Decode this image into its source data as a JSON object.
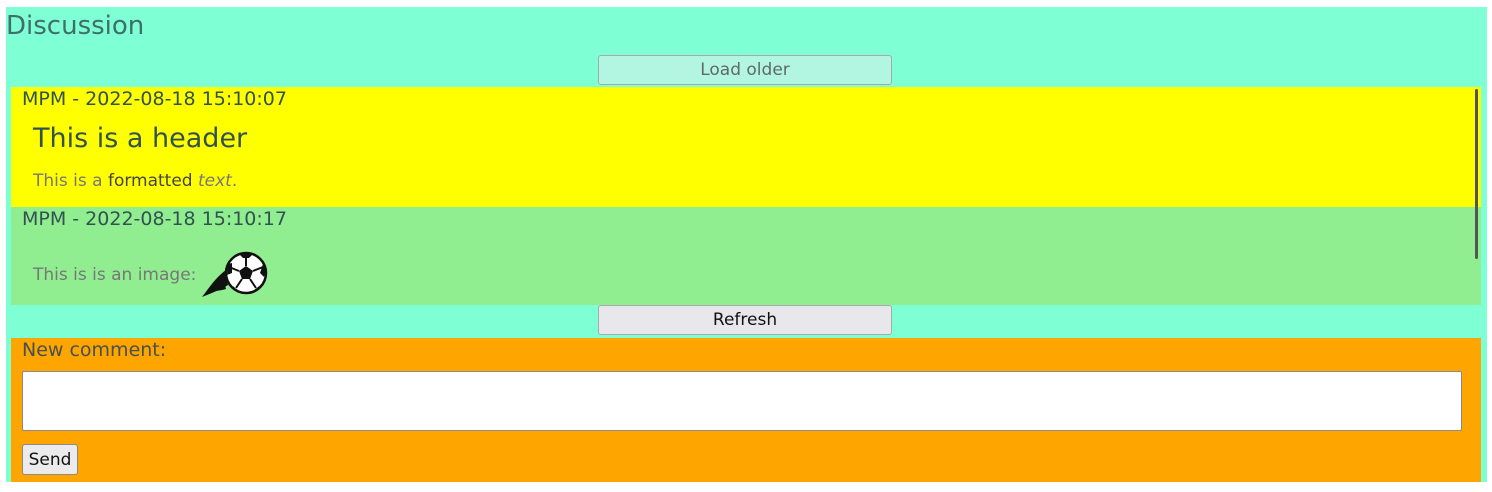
{
  "discussion": {
    "title": "Discussion",
    "load_older_label": "Load older",
    "refresh_label": "Refresh"
  },
  "messages": [
    {
      "meta": "MPM - 2022-08-18 15:10:07",
      "header": "This is a header",
      "text_prefix": "This is a ",
      "text_bold": "formatted",
      "text_space": " ",
      "text_italic": "text",
      "text_suffix": ".",
      "background": "#ffff00"
    },
    {
      "meta": "MPM - 2022-08-18 15:10:17",
      "text": "This is is an image:",
      "image_icon": "soccer-ball-icon",
      "background": "#90ee90"
    }
  ],
  "new_comment": {
    "label": "New comment:",
    "value": "",
    "send_label": "Send",
    "background": "#ffa500"
  },
  "colors": {
    "panel_background": "#7fffd4"
  }
}
